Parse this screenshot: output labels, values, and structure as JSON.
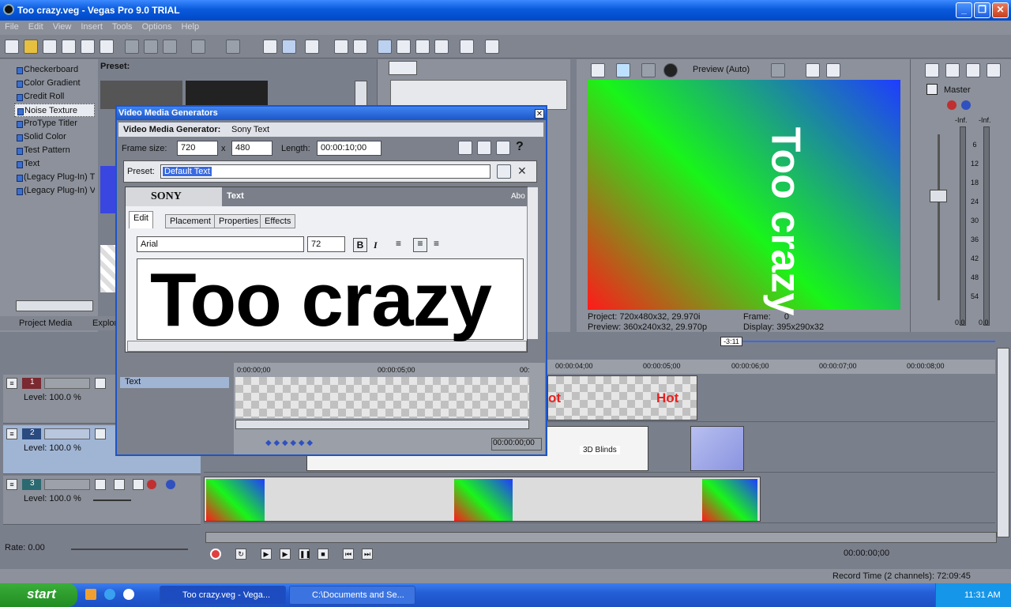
{
  "window": {
    "title": "Too crazy.veg - Vegas Pro 9.0 TRIAL"
  },
  "menu": [
    "File",
    "Edit",
    "View",
    "Insert",
    "Tools",
    "Options",
    "Help"
  ],
  "left_panel": {
    "preset_label": "Preset:",
    "generators": [
      "Checkerboard",
      "Color Gradient",
      "Credit Roll",
      "Noise Texture",
      "ProType Titler",
      "Solid Color",
      "Test Pattern",
      "Text",
      "(Legacy Plug-In) T",
      "(Legacy Plug-In) V"
    ],
    "selected": "Noise Texture",
    "tabs": [
      "Project Media",
      "Explor"
    ]
  },
  "dialog": {
    "title": "Video Media Generators",
    "generator_label": "Video Media Generator:",
    "generator_name": "Sony Text",
    "frame_size_label": "Frame size:",
    "width": "720",
    "x": "x",
    "height": "480",
    "length_label": "Length:",
    "length": "00:00:10;00",
    "preset_label": "Preset:",
    "preset_value": "Default Text",
    "sony_logo": "SONY",
    "plugin_name": "Text",
    "about": "Abo",
    "tabs": [
      "Edit",
      "Placement",
      "Properties",
      "Effects"
    ],
    "font": "Arial",
    "size": "72",
    "bold": "B",
    "italic": "I",
    "text": "Too crazy",
    "track_label": "Text",
    "times": [
      "0:00:00;00",
      "00:00:05;00",
      "00:"
    ],
    "timecode": "00:00:00;00"
  },
  "preview": {
    "label": "Preview (Auto)",
    "overlay_text": "Too crazy",
    "project_label": "Project:",
    "project": "720x480x32, 29.970i",
    "preview_label": "Preview:",
    "preview_val": "360x240x32, 29.970p",
    "frame_label": "Frame:",
    "frame": "0",
    "display_label": "Display:",
    "display": "395x290x32"
  },
  "mixer": {
    "master": "Master",
    "inf_left": "-Inf.",
    "inf_right": "-Inf.",
    "scale": [
      "6",
      "12",
      "18",
      "24",
      "30",
      "36",
      "42",
      "48",
      "54"
    ],
    "bottom_left": "0.0",
    "bottom_right": "0.0"
  },
  "timeline": {
    "cursor": "-3:11",
    "ticks": [
      "00:00:04;00",
      "00:00:05;00",
      "00:00:06;00",
      "00:00:07;00",
      "00:00:08;00"
    ],
    "tracks": [
      {
        "num": "1",
        "level": "Level: 100.0 %",
        "color": "#7a2a30"
      },
      {
        "num": "2",
        "level": "Level: 100.0 %",
        "color": "#2a4a80"
      },
      {
        "num": "3",
        "level": "Level: 100.0 %",
        "color": "#2a6a70"
      }
    ],
    "clip_hot_1": "ot",
    "clip_hot_2": "Hot",
    "transition_label": "3D Blinds",
    "rate": "Rate: 0.00",
    "timecode": "00:00:00;00",
    "record_time": "Record Time (2 channels): 72:09:45"
  },
  "taskbar": {
    "start": "start",
    "tasks": [
      "Too crazy.veg - Vega...",
      "C:\\Documents and Se..."
    ],
    "clock": "11:31 AM"
  }
}
